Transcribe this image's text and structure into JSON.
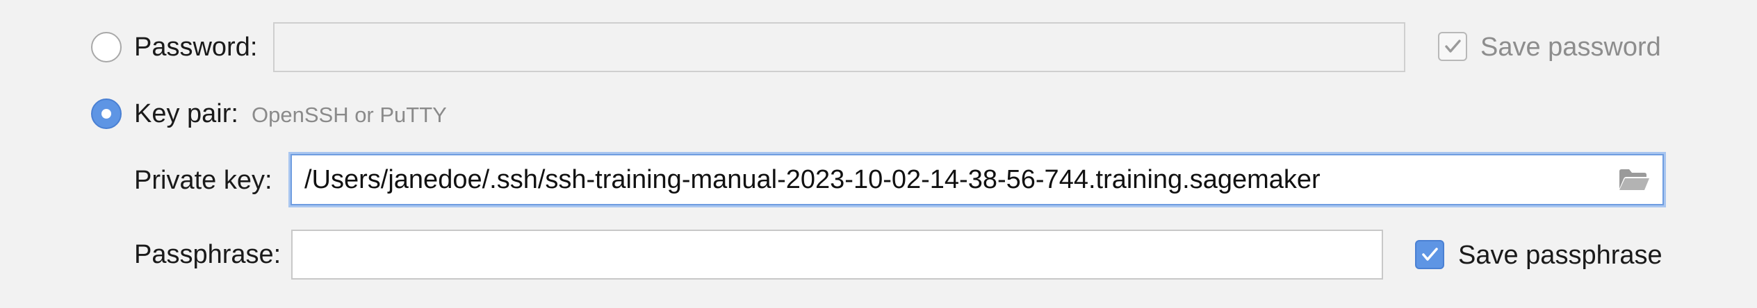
{
  "password": {
    "label": "Password:",
    "value": "",
    "selected": false,
    "save_label": "Save password",
    "save_checked": true,
    "save_enabled": false
  },
  "key_pair": {
    "label": "Key pair:",
    "hint": "OpenSSH or PuTTY",
    "selected": true
  },
  "private_key": {
    "label": "Private key:",
    "value": "/Users/janedoe/.ssh/ssh-training-manual-2023-10-02-14-38-56-744.training.sagemaker",
    "browse_icon": "folder-open-icon"
  },
  "passphrase": {
    "label": "Passphrase:",
    "value": "",
    "save_label": "Save passphrase",
    "save_checked": true
  },
  "colors": {
    "accent": "#5e95e4",
    "background": "#f2f2f2"
  }
}
